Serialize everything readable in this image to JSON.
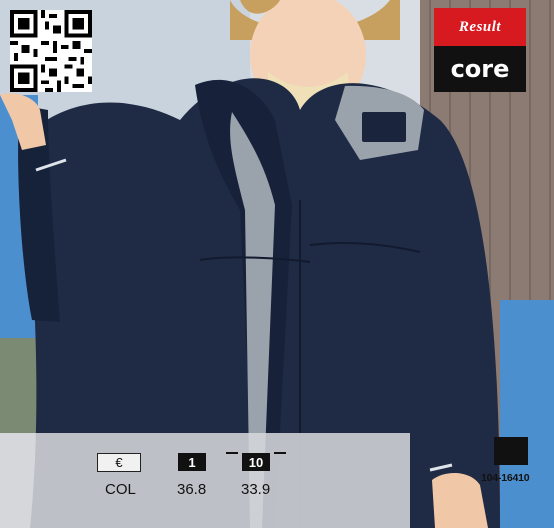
{
  "brand": {
    "top": "Result",
    "bottom": "core"
  },
  "pricing": {
    "currency_symbol": "€",
    "currency_code": "COL",
    "tier1_qty": "1",
    "tier1_price": "36.8",
    "tier2_qty": "10",
    "tier2_price": "33.9"
  },
  "product": {
    "code": "104-16410"
  },
  "colors": {
    "brand_red": "#d71920",
    "navy_jacket": "#1f2b45",
    "grey_trim": "#9aa2ab"
  },
  "icons": {
    "qr": "qr-code-icon",
    "swatch": "color-swatch-icon"
  }
}
